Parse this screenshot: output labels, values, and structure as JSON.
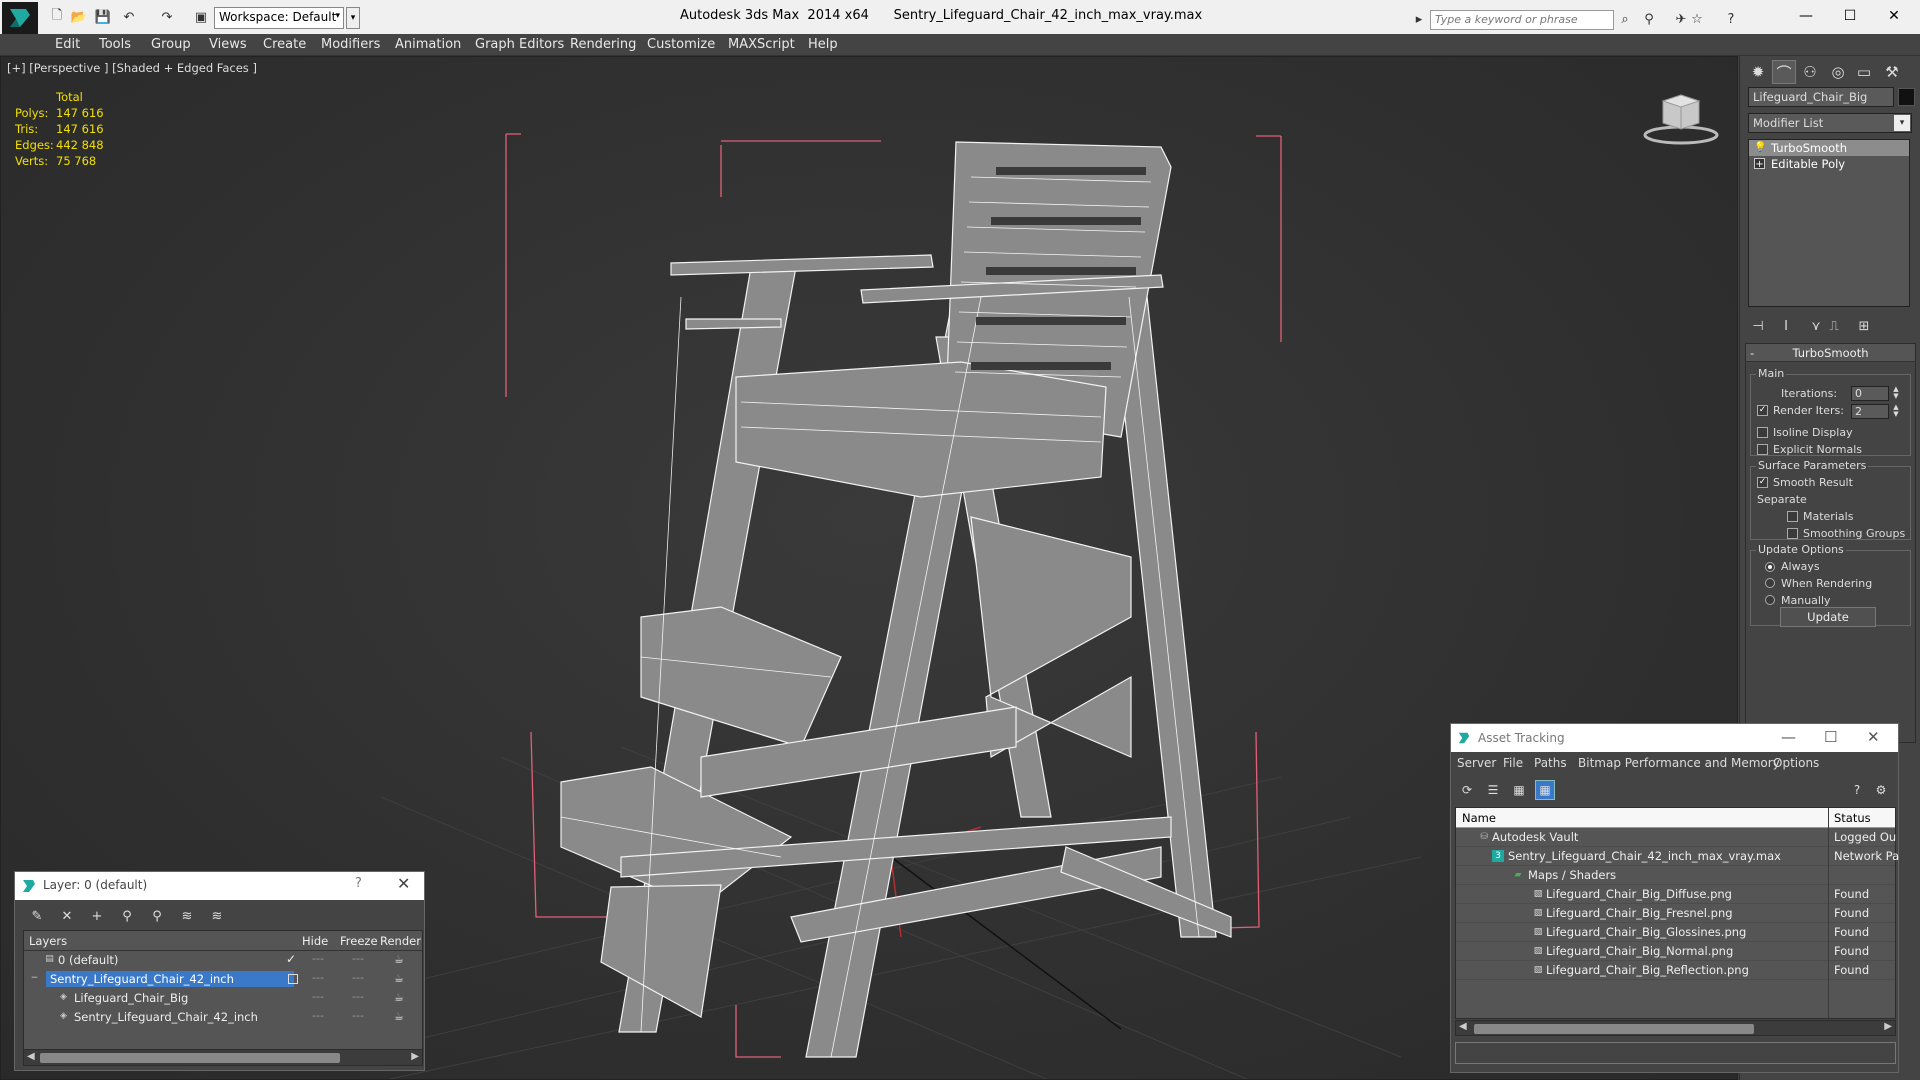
{
  "titlebar": {
    "app_title": "Autodesk 3ds Max  2014 x64      Sentry_Lifeguard_Chair_42_inch_max_vray.max",
    "workspace": "Workspace: Default",
    "search_placeholder": "Type a keyword or phrase"
  },
  "menubar": {
    "items": [
      "Edit",
      "Tools",
      "Group",
      "Views",
      "Create",
      "Modifiers",
      "Animation",
      "Graph Editors",
      "Rendering",
      "Customize",
      "MAXScript",
      "Help"
    ]
  },
  "viewport": {
    "label": "[+] [Perspective ] [Shaded + Edged Faces ]",
    "stats": {
      "header": "Total",
      "rows": [
        {
          "label": "Polys:",
          "value": "147 616"
        },
        {
          "label": "Tris:",
          "value": "147 616"
        },
        {
          "label": "Edges:",
          "value": "442 848"
        },
        {
          "label": "Verts:",
          "value": "75 768"
        }
      ]
    }
  },
  "command_panel": {
    "object_name": "Lifeguard_Chair_Big",
    "modifier_list": "Modifier List",
    "stack": [
      "TurboSmooth",
      "Editable Poly"
    ],
    "rollout_title": "TurboSmooth",
    "main_group": "Main",
    "iterations_label": "Iterations:",
    "iterations_value": "0",
    "render_iters_label": "Render Iters:",
    "render_iters_value": "2",
    "isoline_label": "Isoline Display",
    "explicit_normals_label": "Explicit Normals",
    "surface_group": "Surface Parameters",
    "smooth_result_label": "Smooth Result",
    "separate_label": "Separate",
    "materials_label": "Materials",
    "smoothing_groups_label": "Smoothing Groups",
    "update_group": "Update Options",
    "always_label": "Always",
    "when_rendering_label": "When Rendering",
    "manually_label": "Manually",
    "update_button": "Update"
  },
  "layer_dialog": {
    "title": "Layer: 0 (default)",
    "help": "?",
    "columns": {
      "layers": "Layers",
      "hide": "Hide",
      "freeze": "Freeze",
      "render": "Render"
    },
    "rows": [
      {
        "name": "0 (default)"
      },
      {
        "name": "Sentry_Lifeguard_Chair_42_inch"
      },
      {
        "name": "Lifeguard_Chair_Big"
      },
      {
        "name": "Sentry_Lifeguard_Chair_42_inch"
      }
    ]
  },
  "asset_tracking": {
    "title": "Asset Tracking",
    "menu": [
      "Server",
      "File",
      "Paths",
      "Bitmap Performance and Memory",
      "Options"
    ],
    "columns": {
      "name": "Name",
      "status": "Status"
    },
    "rows": [
      {
        "name": "Autodesk Vault",
        "status": "Logged Ou"
      },
      {
        "name": "Sentry_Lifeguard_Chair_42_inch_max_vray.max",
        "status": "Network Pa"
      },
      {
        "name": "Maps / Shaders",
        "status": ""
      },
      {
        "name": "Lifeguard_Chair_Big_Diffuse.png",
        "status": "Found"
      },
      {
        "name": "Lifeguard_Chair_Big_Fresnel.png",
        "status": "Found"
      },
      {
        "name": "Lifeguard_Chair_Big_Glossines.png",
        "status": "Found"
      },
      {
        "name": "Lifeguard_Chair_Big_Normal.png",
        "status": "Found"
      },
      {
        "name": "Lifeguard_Chair_Big_Reflection.png",
        "status": "Found"
      }
    ]
  },
  "colors": {
    "stats_text": "#f2e000",
    "selection": "#3a78c8",
    "bbox_brackets": "#e0607a",
    "wireframe": "#f0f0f0"
  }
}
